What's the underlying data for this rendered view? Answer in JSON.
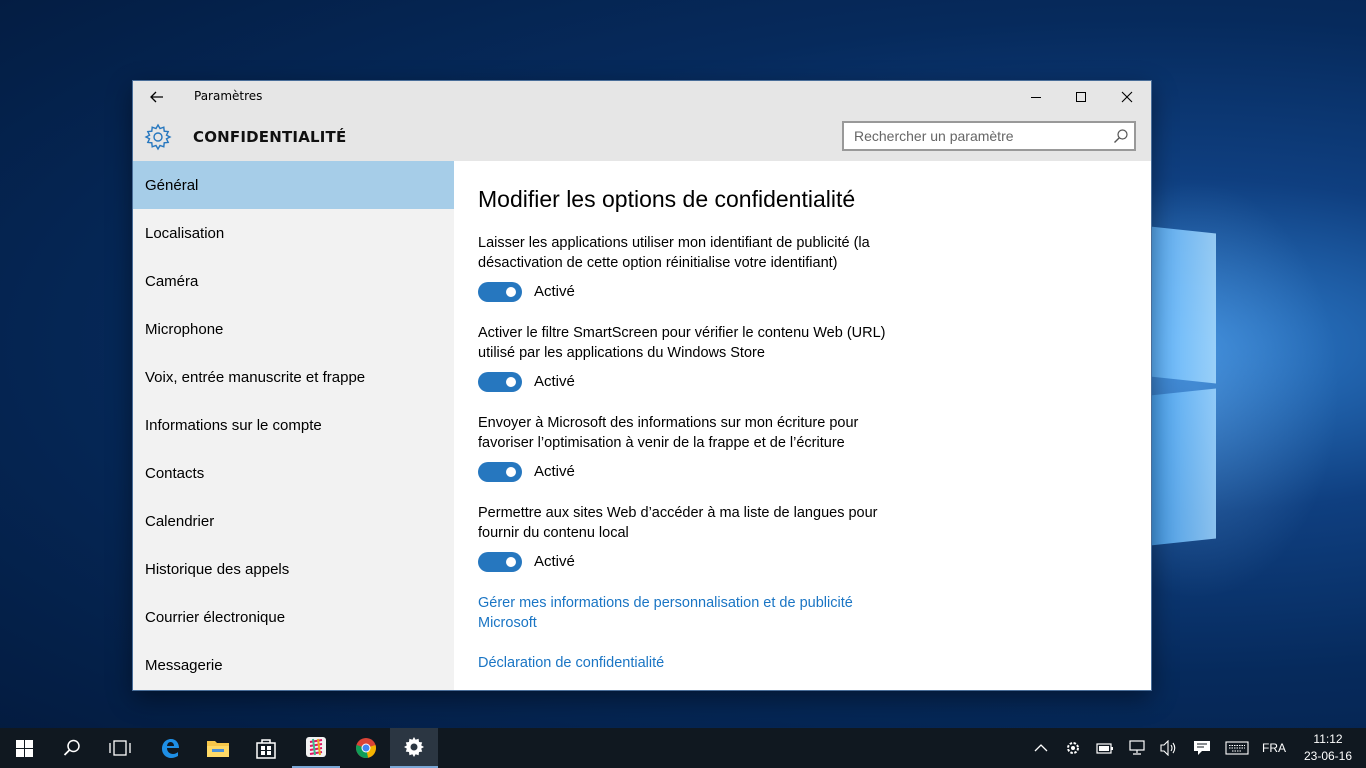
{
  "window": {
    "title": "Paramètres",
    "section_title": "CONFIDENTIALITÉ",
    "search_placeholder": "Rechercher un paramètre"
  },
  "sidebar": {
    "items": [
      {
        "label": "Général",
        "selected": true
      },
      {
        "label": "Localisation"
      },
      {
        "label": "Caméra"
      },
      {
        "label": "Microphone"
      },
      {
        "label": "Voix, entrée manuscrite et frappe"
      },
      {
        "label": "Informations sur le compte"
      },
      {
        "label": "Contacts"
      },
      {
        "label": "Calendrier"
      },
      {
        "label": "Historique des appels"
      },
      {
        "label": "Courrier électronique"
      },
      {
        "label": "Messagerie"
      }
    ]
  },
  "main": {
    "title": "Modifier les options de confidentialité",
    "options": [
      {
        "description": "Laisser les applications utiliser mon identifiant de publicité (la désactivation de cette option réinitialise votre identifiant)",
        "state": "Activé",
        "on": true
      },
      {
        "description": "Activer le filtre SmartScreen pour vérifier le contenu Web (URL) utilisé par les applications du Windows Store",
        "state": "Activé",
        "on": true
      },
      {
        "description": "Envoyer à Microsoft des informations sur mon écriture pour favoriser l’optimisation à venir de la frappe et de l’écriture",
        "state": "Activé",
        "on": true
      },
      {
        "description": "Permettre aux sites Web d’accéder à ma liste de langues pour fournir du contenu local",
        "state": "Activé",
        "on": true
      }
    ],
    "links": [
      "Gérer mes informations de personnalisation et de publicité Microsoft",
      "Déclaration de confidentialité"
    ]
  },
  "taskbar": {
    "apps": [
      "start-button",
      "search",
      "task-view",
      "edge",
      "file-explorer",
      "store",
      "slack",
      "chrome",
      "settings"
    ],
    "language": "FRA",
    "time": "11:12",
    "date": "23-06-16"
  },
  "colors": {
    "accent": "#2677bf",
    "selected_nav": "#a6cde8",
    "link": "#1a75c4"
  }
}
